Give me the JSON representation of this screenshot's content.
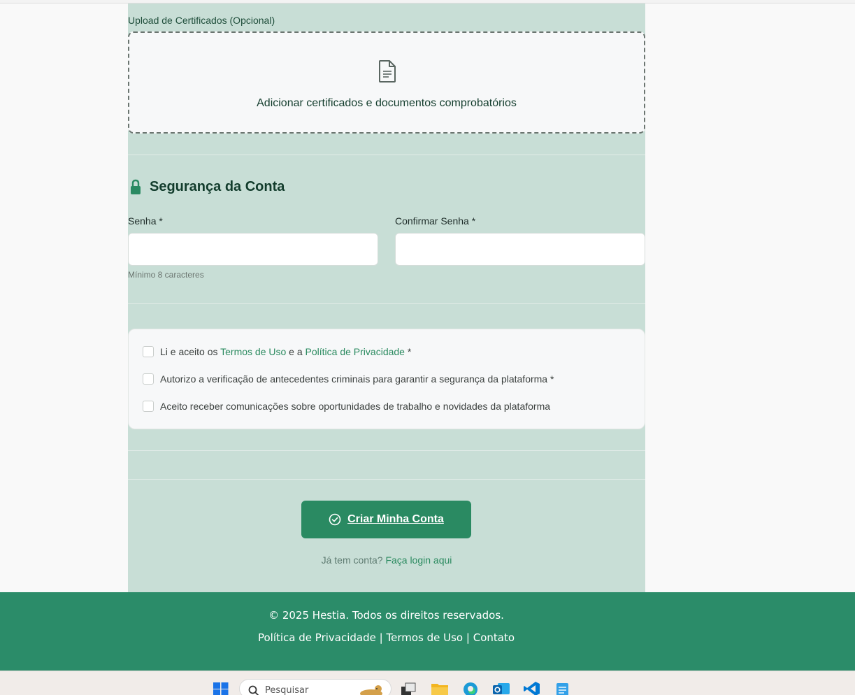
{
  "upload": {
    "label": "Upload de Certificados (Opcional)",
    "dropzone_text": "Adicionar certificados e documentos comprobatórios"
  },
  "security": {
    "title": "Segurança da Conta",
    "password_label": "Senha *",
    "password_value": "",
    "confirm_label": "Confirmar Senha *",
    "confirm_value": "",
    "hint": "Mínimo 8 caracteres"
  },
  "consents": [
    {
      "prefix": "Li e aceito os ",
      "link1": "Termos de Uso",
      "middle": " e a ",
      "link2": "Política de Privacidade",
      "suffix": " *",
      "checked": false
    },
    {
      "text": "Autorizo a verificação de antecedentes criminais para garantir a segurança da plataforma *",
      "checked": false
    },
    {
      "text": "Aceito receber comunicações sobre oportunidades de trabalho e novidades da plataforma",
      "checked": false
    }
  ],
  "submit": {
    "label": "Criar Minha Conta",
    "icon": "check-circle-icon"
  },
  "login": {
    "prompt": "Já tem conta? ",
    "link": "Faça login aqui"
  },
  "footer": {
    "copyright": "© 2025 Hestia. Todos os direitos reservados.",
    "links": [
      "Política de Privacidade",
      "Termos de Uso",
      "Contato"
    ],
    "separator": "|"
  },
  "taskbar": {
    "search_placeholder": "Pesquisar",
    "apps": [
      "windows-start-icon",
      "task-view-icon",
      "file-explorer-icon",
      "edge-icon",
      "outlook-icon",
      "vscode-icon",
      "notepad-icon"
    ]
  },
  "colors": {
    "panel": "#c8ded6",
    "accent": "#2a8a62",
    "footer": "#2b8c69",
    "title": "#123c2c"
  }
}
